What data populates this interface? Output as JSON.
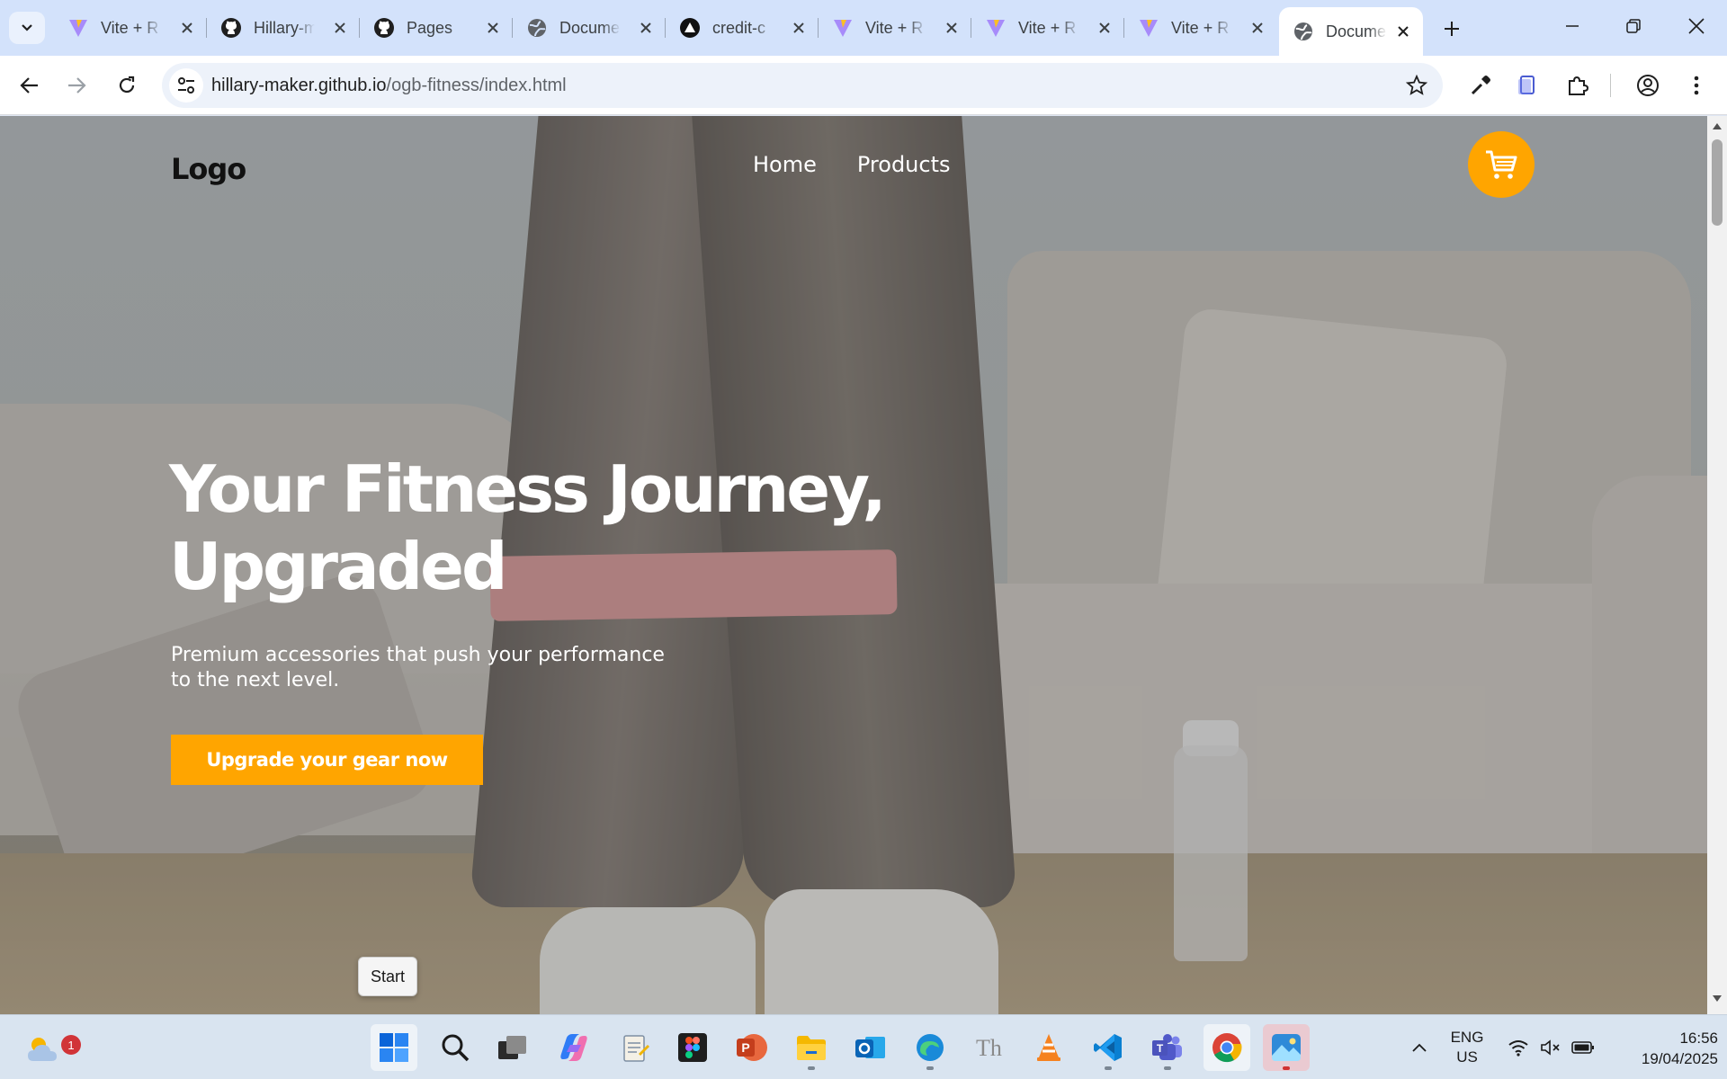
{
  "browser": {
    "tabs": [
      {
        "title": "Vite + R",
        "icon": "vite-icon"
      },
      {
        "title": "Hillary-m",
        "icon": "github-icon"
      },
      {
        "title": "Pages",
        "icon": "github-icon"
      },
      {
        "title": "Docume",
        "icon": "globe-icon"
      },
      {
        "title": "credit-c",
        "icon": "vercel-icon"
      },
      {
        "title": "Vite + R",
        "icon": "vite-icon"
      },
      {
        "title": "Vite + R",
        "icon": "vite-icon"
      },
      {
        "title": "Vite + R",
        "icon": "vite-icon"
      },
      {
        "title": "Docume",
        "icon": "globe-icon",
        "active": true
      }
    ],
    "url_host": "hillary-maker.github.io",
    "url_path": "/ogb-fitness/index.html"
  },
  "site": {
    "logo": "Logo",
    "nav": [
      "Home",
      "Products"
    ],
    "hero_title_line1": "Your Fitness Journey,",
    "hero_title_line2": "Upgraded",
    "hero_subtitle_line1": "Premium accessories that push your performance",
    "hero_subtitle_line2": "to the next level.",
    "cta_label": "Upgrade your gear now",
    "accent_color": "#ffa500"
  },
  "tooltip": {
    "start": "Start"
  },
  "taskbar": {
    "weather_badge": "1",
    "apps": [
      "windows-start-icon",
      "search-icon",
      "task-view-icon",
      "copilot-icon",
      "notepad-icon",
      "figma-icon",
      "powerpoint-icon",
      "file-explorer-icon",
      "outlook-icon",
      "edge-icon",
      "font-app-icon",
      "vlc-icon",
      "vscode-icon",
      "teams-icon",
      "chrome-icon",
      "photos-icon"
    ],
    "lang_line1": "ENG",
    "lang_line2": "US",
    "time": "16:56",
    "date": "19/04/2025"
  }
}
